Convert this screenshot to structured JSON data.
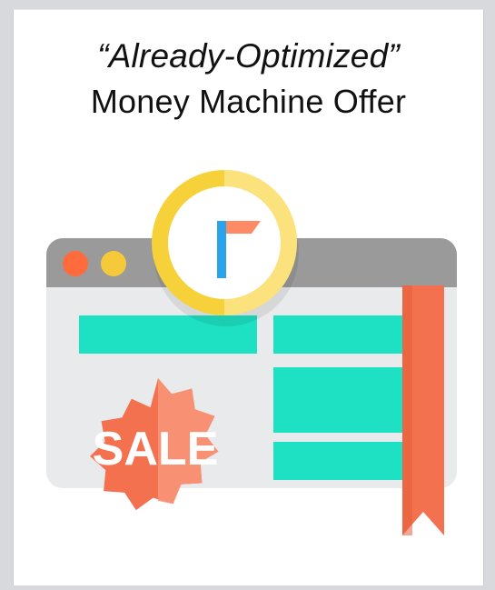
{
  "card": {
    "title_line1": "“Already-Optimized”",
    "title_line2": "Money Machine Offer"
  },
  "illustration": {
    "badge_text": "SALE",
    "icons": {
      "browser": "browser-window-icon",
      "clock": "clock-badge-icon",
      "sale": "sale-seal-icon",
      "ribbon": "bookmark-ribbon-icon"
    }
  },
  "colors": {
    "teal": "#1ee0c2",
    "browser_bar": "#9a9a9a",
    "browser_body": "#e9eaec",
    "yellow_dark": "#f7d13a",
    "yellow_light": "#fbe27c",
    "coral": "#f3714e",
    "coral_light": "#f8977a",
    "dot_orange": "#ff6b3d",
    "dot_yellow": "#f6c93a",
    "logo_blue": "#2aa3ea",
    "logo_orange": "#ff8a66"
  }
}
